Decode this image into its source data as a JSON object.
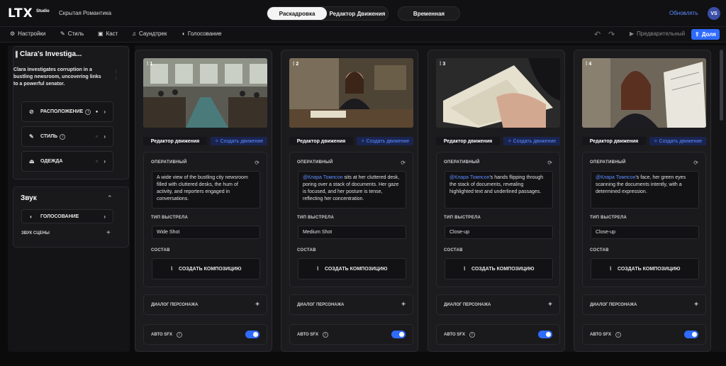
{
  "app": {
    "logo": "LTX",
    "logo_sub": "Studio",
    "project_title": "Скрытая Романтика"
  },
  "header": {
    "tabs": [
      {
        "label": "Раскадровка",
        "active": true
      },
      {
        "label": "Редактор Движения",
        "active": false
      }
    ],
    "timeline_label": "Временная",
    "upgrade_label": "Обновлять",
    "avatar_initials": "VS"
  },
  "toolbar": {
    "items": [
      {
        "label": "Настройки",
        "icon": "settings-icon"
      },
      {
        "label": "Стиль",
        "icon": "brush-icon"
      },
      {
        "label": "Каст",
        "icon": "cast-icon"
      },
      {
        "label": "Саундтрек",
        "icon": "music-icon"
      },
      {
        "label": "Голосование",
        "icon": "voice-icon"
      }
    ],
    "preview_label": "Предварительный",
    "share_label": "Доля"
  },
  "sidebar": {
    "scene_title": "Clara's Investiga...",
    "scene_description": "Clara investigates corruption in a bustling newsroom, uncovering links to a powerful senator.",
    "rows": [
      {
        "label": "РАСПОЛОЖЕНИЕ",
        "icon": "compass-icon"
      },
      {
        "label": "СТИЛЬ",
        "icon": "brush-icon"
      },
      {
        "label": "ОДЕЖДА",
        "icon": "hanger-icon"
      }
    ],
    "sound": {
      "title": "Звук",
      "voiceover_label": "ГОЛОСОВАНИЕ",
      "scene_sound_label": "ЗВУК СЦЕНЫ"
    }
  },
  "accent_color": "#2f6bff",
  "shots": [
    {
      "number": "1",
      "mention": "",
      "prompt": "A wide view of the bustling city newsroom filled with cluttered desks, the hum of activity, and reporters engaged in conversations.",
      "shot_type": "Wide Shot"
    },
    {
      "number": "2",
      "mention": "@Клара Томпсон",
      "prompt": " sits at her cluttered desk, poring over a stack of documents. Her gaze is focused, and her posture is tense, reflecting her concentration.",
      "shot_type": "Medium Shot"
    },
    {
      "number": "3",
      "mention": "@Клара Томпсон",
      "prompt": "'s hands flipping through the stack of documents, revealing highlighted text and underlined passages.",
      "shot_type": "Close-up"
    },
    {
      "number": "4",
      "mention": "@Клара Томпсон",
      "prompt": "'s face, her green eyes scanning the documents intently, with a determined expression.",
      "shot_type": "Close-up"
    }
  ],
  "labels": {
    "edit_motion": "Редактор движения",
    "create_motion": "Создать движение",
    "prompt_heading": "ОПЕРАТИВНЫЙ",
    "shot_type_heading": "ТИП ВЫСТРЕЛА",
    "composition_heading": "СОСТАВ",
    "create_composition": "СОЗДАТЬ КОМПОЗИЦИЮ",
    "character_dialog": "ДИАЛОГ ПЕРСОНАЖА",
    "auto_sfx": "АВТО SFX"
  }
}
